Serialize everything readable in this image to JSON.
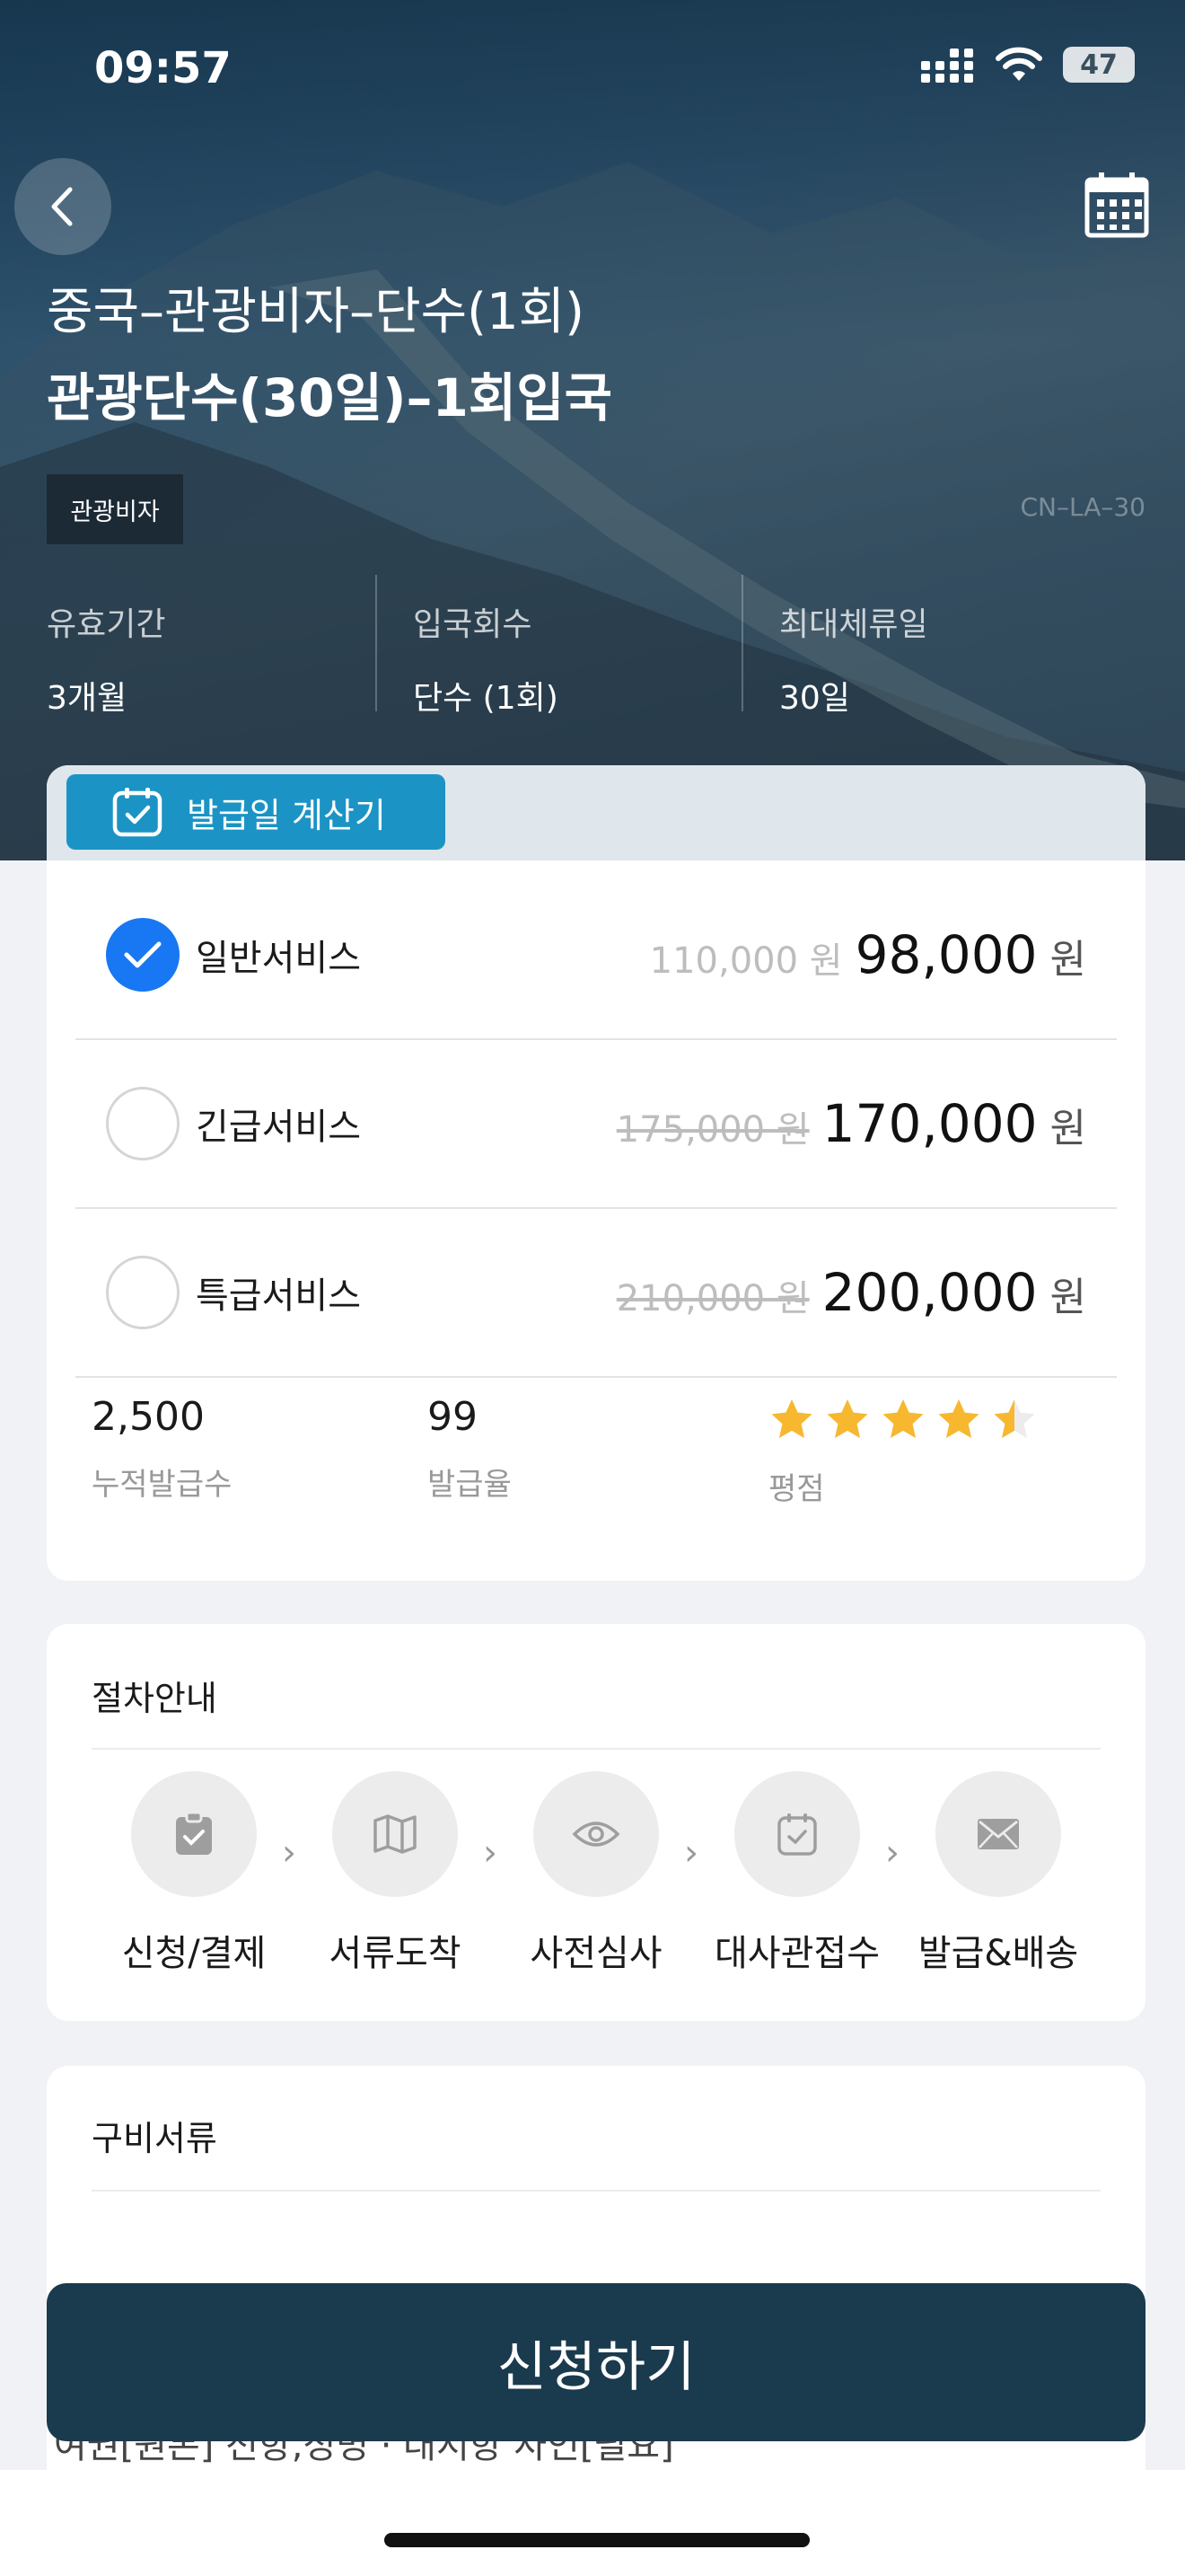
{
  "status_bar": {
    "time": "09:57",
    "battery": "47"
  },
  "header": {
    "title_line1": "중국–관광비자–단수(1회)",
    "title_line2": "관광단수(30일)–1회입국",
    "tag": "관광비자",
    "code": "CN–LA–30"
  },
  "meta": [
    {
      "label": "유효기간",
      "value": "3개월"
    },
    {
      "label": "입국회수",
      "value": "단수 (1회)"
    },
    {
      "label": "최대체류일",
      "value": "30일"
    }
  ],
  "calculator_label": "발급일 계산기",
  "options": [
    {
      "label": "일반서비스",
      "old_price": "110,000 원",
      "price": "98,000",
      "unit": "원",
      "selected": true
    },
    {
      "label": "긴급서비스",
      "old_price": "175,000 원",
      "price": "170,000",
      "unit": "원",
      "selected": false
    },
    {
      "label": "특급서비스",
      "old_price": "210,000 원",
      "price": "200,000",
      "unit": "원",
      "selected": false
    }
  ],
  "stats": [
    {
      "value": "2,500",
      "label": "누적발급수"
    },
    {
      "value": "99",
      "label": "발급율"
    },
    {
      "label": "평점",
      "rating": 4.5,
      "max": 5
    }
  ],
  "procedure": {
    "title": "절차안내",
    "steps": [
      {
        "label": "신청/결제",
        "icon": "clipboard-icon"
      },
      {
        "label": "서류도착",
        "icon": "map-icon"
      },
      {
        "label": "사전심사",
        "icon": "eye-icon"
      },
      {
        "label": "대사관접수",
        "icon": "calendar-check-icon"
      },
      {
        "label": "발급&배송",
        "icon": "envelope-icon"
      }
    ],
    "separator": "›"
  },
  "documents": {
    "title": "구비서류",
    "partial_text": "여권[원본] 전항,성명 · 대서항 사인[필요]"
  },
  "apply_button": "신청하기",
  "colors": {
    "accent_blue": "#1b94c5",
    "check_blue": "#1877f2",
    "apply_button": "#1a3a4e",
    "star": "#f7b82f"
  }
}
